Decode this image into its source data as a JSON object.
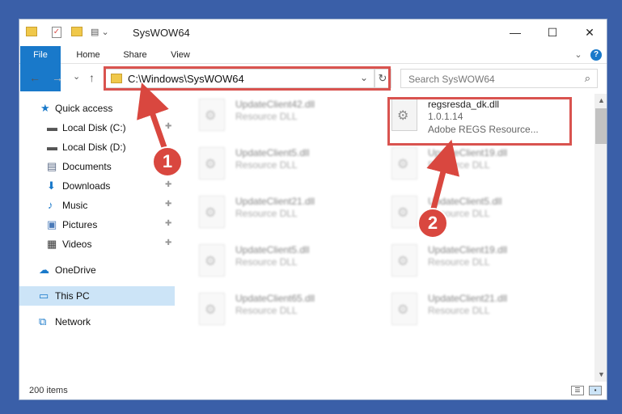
{
  "window": {
    "title": "SysWOW64",
    "minimize": "—",
    "maximize": "☐",
    "close": "✕",
    "help": "?"
  },
  "ribbon": {
    "tabs": [
      "File",
      "Home",
      "Share",
      "View"
    ],
    "expand": "⌄"
  },
  "nav": {
    "back": "←",
    "forward": "→",
    "recent": "⌄",
    "up": "↑",
    "address": "C:\\Windows\\SysWOW64",
    "address_dropdown": "⌄",
    "refresh": "↻",
    "search_placeholder": "Search SysWOW64",
    "search_icon": "⌕"
  },
  "sidebar": {
    "items": [
      {
        "label": "Quick access",
        "icon": "star-icon",
        "glyph": "★",
        "color": "#1979ca"
      },
      {
        "label": "Local Disk (C:)",
        "icon": "drive-icon",
        "glyph": "▬",
        "color": "#555555"
      },
      {
        "label": "Local Disk (D:)",
        "icon": "drive-icon",
        "glyph": "▬",
        "color": "#555555"
      },
      {
        "label": "Documents",
        "icon": "documents-icon",
        "glyph": "▤",
        "color": "#5a6a86"
      },
      {
        "label": "Downloads",
        "icon": "download-icon",
        "glyph": "⬇",
        "color": "#1979ca"
      },
      {
        "label": "Music",
        "icon": "music-icon",
        "glyph": "♪",
        "color": "#1979ca"
      },
      {
        "label": "Pictures",
        "icon": "pictures-icon",
        "glyph": "▣",
        "color": "#4a7ab8"
      },
      {
        "label": "Videos",
        "icon": "videos-icon",
        "glyph": "▦",
        "color": "#333333"
      },
      {
        "label": "OneDrive",
        "icon": "cloud-icon",
        "glyph": "☁",
        "color": "#1979ca"
      },
      {
        "label": "This PC",
        "icon": "computer-icon",
        "glyph": "▭",
        "color": "#1979ca"
      },
      {
        "label": "Network",
        "icon": "network-icon",
        "glyph": "⧉",
        "color": "#1979ca"
      }
    ],
    "pin_glyph": "📌"
  },
  "files": [
    {
      "name": "UpdateClient42.dll",
      "desc": "Resource DLL"
    },
    {
      "name": "regsresda_dk.dll",
      "version": "1.0.1.14",
      "desc": "Adobe REGS Resource..."
    },
    {
      "name": "UpdateClient5.dll",
      "desc": "Resource DLL"
    },
    {
      "name": "UpdateClient19.dll",
      "desc": "Resource DLL"
    },
    {
      "name": "UpdateClient21.dll",
      "desc": "Resource DLL"
    },
    {
      "name": "UpdateClient5.dll",
      "desc": "Resource DLL"
    },
    {
      "name": "UpdateClient5.dll",
      "desc": "Resource DLL"
    },
    {
      "name": "UpdateClient19.dll",
      "desc": "Resource DLL"
    },
    {
      "name": "UpdateClient65.dll",
      "desc": "Resource DLL"
    },
    {
      "name": "UpdateClient21.dll",
      "desc": "Resource DLL"
    }
  ],
  "status": {
    "item_count": "200 items"
  },
  "callouts": {
    "one": "1",
    "two": "2"
  },
  "colors": {
    "accent": "#1979ca",
    "highlight": "#d9534f",
    "selected_nav": "#cce4f7"
  }
}
